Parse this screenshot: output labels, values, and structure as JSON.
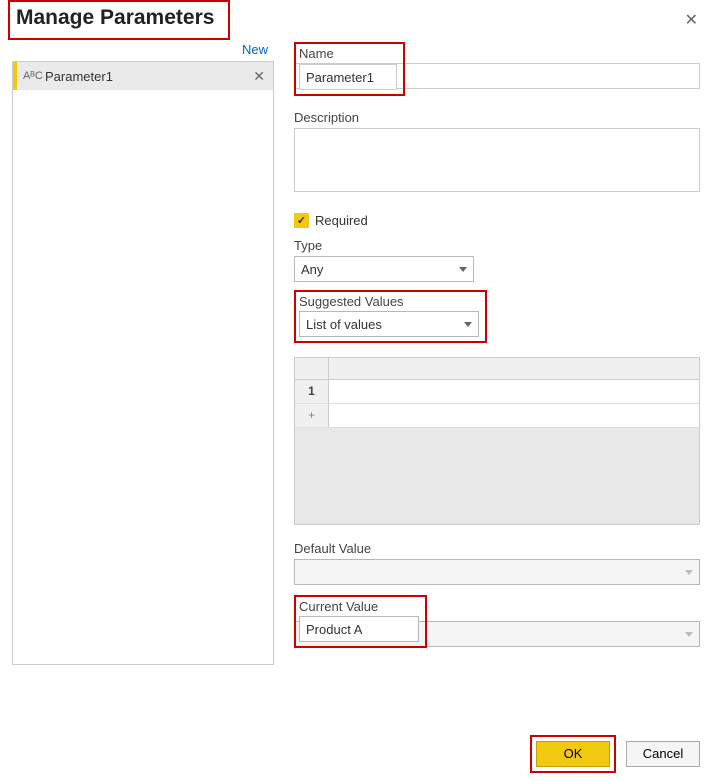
{
  "dialog": {
    "title": "Manage Parameters",
    "close_glyph": "✕"
  },
  "sidebar": {
    "new_label": "New",
    "param_type_glyph": "AᴮC",
    "items": [
      {
        "label": "Parameter1",
        "delete_glyph": "✕"
      }
    ]
  },
  "form": {
    "name_label": "Name",
    "name_value": "Parameter1",
    "description_label": "Description",
    "description_value": "",
    "required_label": "Required",
    "required_checked": true,
    "check_glyph": "✓",
    "type_label": "Type",
    "type_value": "Any",
    "suggested_label": "Suggested Values",
    "suggested_value": "List of values",
    "grid": {
      "row1_index": "1",
      "add_row": "+"
    },
    "default_label": "Default Value",
    "default_value": "",
    "current_label": "Current Value",
    "current_value": "Product A"
  },
  "footer": {
    "ok": "OK",
    "cancel": "Cancel"
  }
}
